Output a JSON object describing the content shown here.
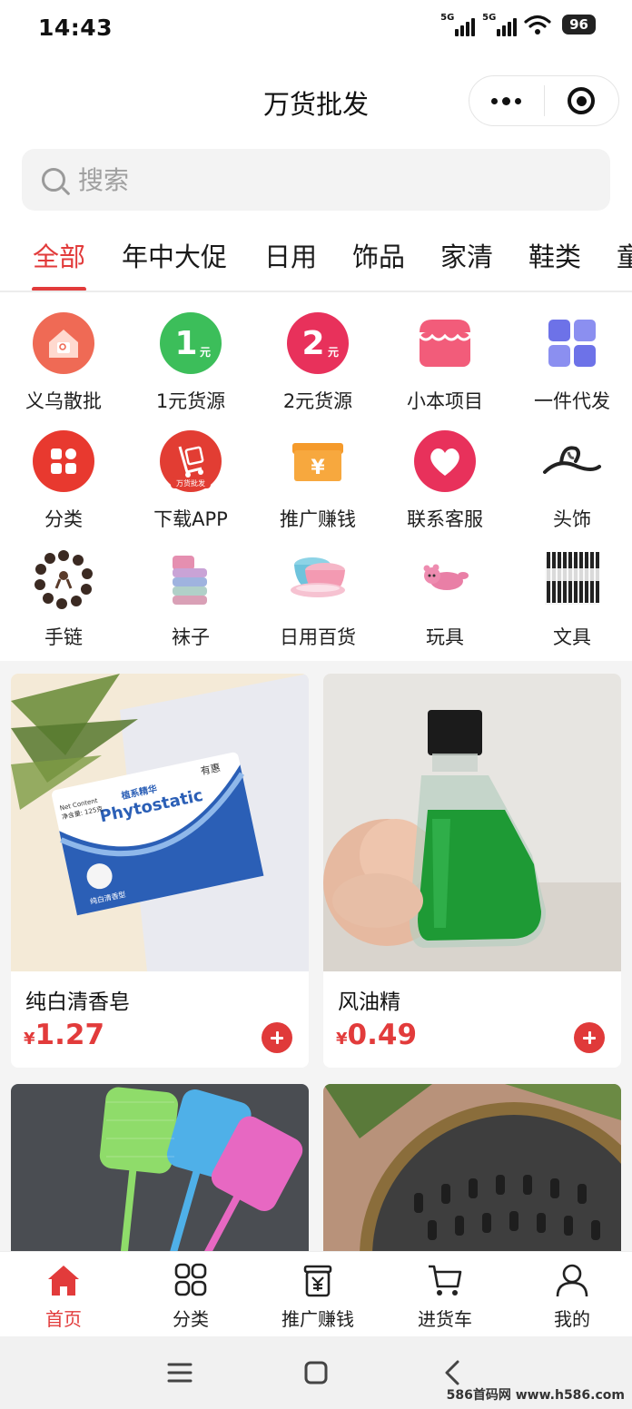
{
  "status_bar": {
    "time": "14:43",
    "signal_1": "5G",
    "signal_2": "5G",
    "battery": "96"
  },
  "header": {
    "title": "万货批发",
    "more_icon": "more-dots-icon",
    "close_icon": "target-icon"
  },
  "search": {
    "placeholder": "搜索"
  },
  "tabs": [
    {
      "label": "全部"
    },
    {
      "label": "年中大促"
    },
    {
      "label": "日用"
    },
    {
      "label": "饰品"
    },
    {
      "label": "家清"
    },
    {
      "label": "鞋类"
    },
    {
      "label": "童"
    }
  ],
  "categories": [
    {
      "label": "义乌散批",
      "icon": "house-icon"
    },
    {
      "label": "1元货源",
      "icon": "one-yuan-icon",
      "badge": "1",
      "unit": "元"
    },
    {
      "label": "2元货源",
      "icon": "two-yuan-icon",
      "badge": "2",
      "unit": "元"
    },
    {
      "label": "小本项目",
      "icon": "store-awning-icon"
    },
    {
      "label": "一件代发",
      "icon": "grid-icon"
    },
    {
      "label": "分类",
      "icon": "category-icon"
    },
    {
      "label": "下载APP",
      "icon": "download-app-icon",
      "badge_text": "万货批发"
    },
    {
      "label": "推广赚钱",
      "icon": "yuan-box-icon",
      "badge": "¥"
    },
    {
      "label": "联系客服",
      "icon": "heart-icon"
    },
    {
      "label": "头饰",
      "icon": "hair-clip-icon"
    },
    {
      "label": "手链",
      "icon": "bracelet-icon"
    },
    {
      "label": "袜子",
      "icon": "socks-icon"
    },
    {
      "label": "日用百货",
      "icon": "basin-icon"
    },
    {
      "label": "玩具",
      "icon": "toy-icon"
    },
    {
      "label": "文具",
      "icon": "pens-icon"
    }
  ],
  "products": [
    {
      "name": "纯白清香皂",
      "currency": "¥",
      "price": "1.27",
      "image": "soap-image",
      "img_text_brand": "有惠",
      "img_text_name": "Phytostatic",
      "img_text_net": "Net Content",
      "img_text_weight": "净含量: 125克",
      "img_text_small": "纯白清香型",
      "img_text_cn": "植系精华"
    },
    {
      "name": "风油精",
      "currency": "¥",
      "price": "0.49",
      "image": "green-oil-bottle-image"
    },
    {
      "name": "",
      "currency": "",
      "price": "",
      "image": "fly-swatter-image"
    },
    {
      "name": "",
      "currency": "",
      "price": "",
      "image": "drain-cover-image"
    }
  ],
  "bottom_nav": [
    {
      "label": "首页",
      "icon": "home-icon",
      "active": true
    },
    {
      "label": "分类",
      "icon": "four-squares-icon",
      "active": false
    },
    {
      "label": "推广赚钱",
      "icon": "yuan-bag-icon",
      "active": false
    },
    {
      "label": "进货车",
      "icon": "cart-icon",
      "active": false
    },
    {
      "label": "我的",
      "icon": "user-icon",
      "active": false
    }
  ],
  "watermark": "586首码网 www.h586.com",
  "colors": {
    "accent": "#e23b3b",
    "text": "#1a1a1a",
    "muted": "#a0a0a0",
    "background_band": "#f4f4f4"
  }
}
